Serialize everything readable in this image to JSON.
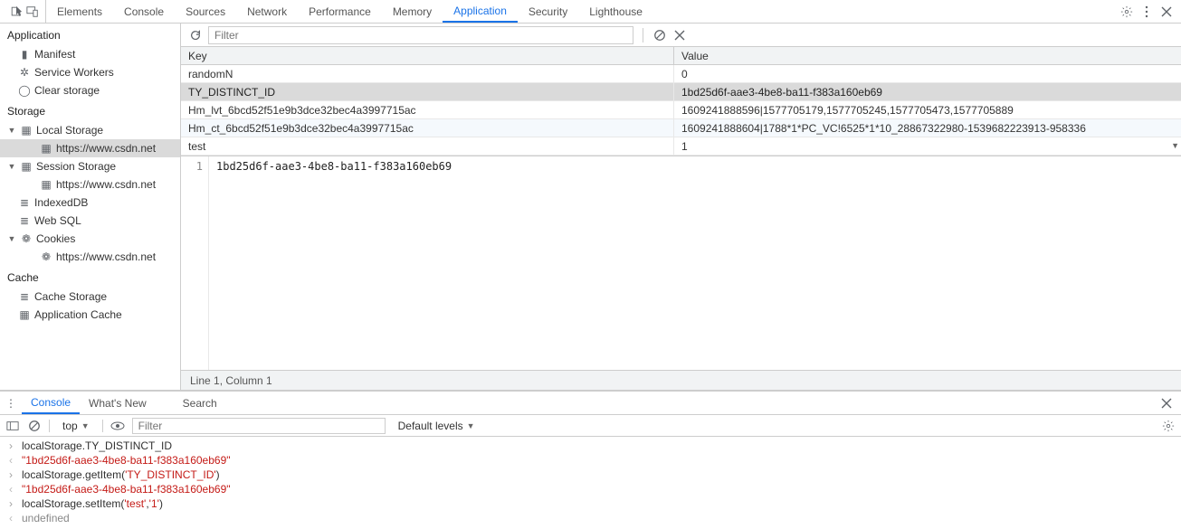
{
  "tabs": [
    "Elements",
    "Console",
    "Sources",
    "Network",
    "Performance",
    "Memory",
    "Application",
    "Security",
    "Lighthouse"
  ],
  "activeTab": "Application",
  "sidebar": {
    "section_app": "Application",
    "app_items": [
      "Manifest",
      "Service Workers",
      "Clear storage"
    ],
    "section_storage": "Storage",
    "local_storage": "Local Storage",
    "session_storage": "Session Storage",
    "indexeddb": "IndexedDB",
    "websql": "Web SQL",
    "cookies": "Cookies",
    "origin": "https://www.csdn.net",
    "section_cache": "Cache",
    "cache_storage": "Cache Storage",
    "app_cache": "Application Cache"
  },
  "toolbar": {
    "filter_placeholder": "Filter"
  },
  "table": {
    "head_key": "Key",
    "head_value": "Value",
    "rows": [
      {
        "k": "randomN",
        "v": "0"
      },
      {
        "k": "TY_DISTINCT_ID",
        "v": "1bd25d6f-aae3-4be8-ba11-f383a160eb69"
      },
      {
        "k": "Hm_lvt_6bcd52f51e9b3dce32bec4a3997715ac",
        "v": "1609241888596|1577705179,1577705245,1577705473,1577705889"
      },
      {
        "k": "Hm_ct_6bcd52f51e9b3dce32bec4a3997715ac",
        "v": "1609241888604|1788*1*PC_VC!6525*1*10_28867322980-1539682223913-958336"
      },
      {
        "k": "test",
        "v": "1"
      }
    ],
    "selectedIndex": 1
  },
  "preview": {
    "line_no": "1",
    "content": "1bd25d6f-aae3-4be8-ba11-f383a160eb69"
  },
  "status": "Line 1, Column 1",
  "drawer": {
    "tabs": [
      "Console",
      "What's New",
      "Search"
    ],
    "ctx": "top",
    "filter_placeholder": "Filter",
    "levels": "Default levels"
  },
  "console": [
    {
      "dir": "in",
      "plain": "localStorage.TY_DISTINCT_ID"
    },
    {
      "dir": "out",
      "str": "\"1bd25d6f-aae3-4be8-ba11-f383a160eb69\""
    },
    {
      "dir": "in",
      "pre": "localStorage.getItem(",
      "str": "'TY_DISTINCT_ID'",
      "post": ")"
    },
    {
      "dir": "out",
      "str": "\"1bd25d6f-aae3-4be8-ba11-f383a160eb69\""
    },
    {
      "dir": "in",
      "pre": "localStorage.setItem(",
      "str": "'test'",
      "mid": ",",
      "str2": "'1'",
      "post": ")"
    },
    {
      "dir": "out",
      "undef": "undefined"
    }
  ]
}
